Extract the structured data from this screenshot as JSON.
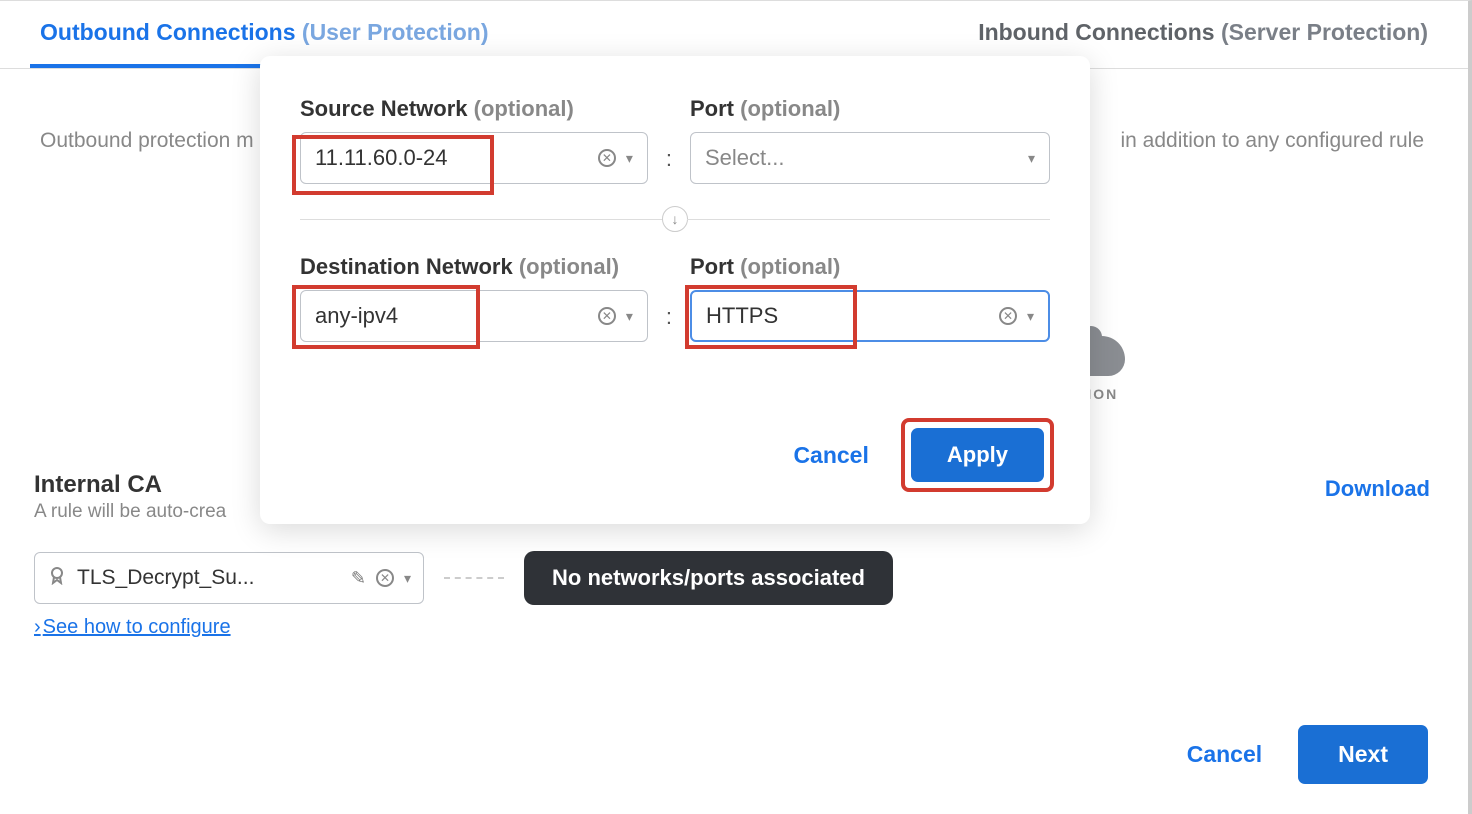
{
  "tabs": {
    "outbound": {
      "title": "Outbound Connections",
      "sub": "(User Protection)"
    },
    "inbound": {
      "title": "Inbound Connections",
      "sub": "(Server Protection)"
    }
  },
  "description": {
    "leading": "Outbound protection m",
    "trailing": "in addition to any configured rule"
  },
  "cloud_label_fragment": "TION",
  "popover": {
    "source_network": {
      "label": "Source Network",
      "optional": "(optional)",
      "value": "11.11.60.0-24"
    },
    "source_port": {
      "label": "Port",
      "optional": "(optional)",
      "placeholder": "Select..."
    },
    "dest_network": {
      "label": "Destination Network",
      "optional": "(optional)",
      "value": "any-ipv4"
    },
    "dest_port": {
      "label": "Port",
      "optional": "(optional)",
      "value": "HTTPS"
    },
    "cancel": "Cancel",
    "apply": "Apply"
  },
  "internal_ca": {
    "title": "Internal CA",
    "subtitle": "A rule will be auto-crea",
    "cert_name": "TLS_Decrypt_Su...",
    "pill": "No networks/ports associated",
    "download": "Download",
    "configure_link": "See how to configure"
  },
  "footer": {
    "cancel": "Cancel",
    "next": "Next"
  }
}
